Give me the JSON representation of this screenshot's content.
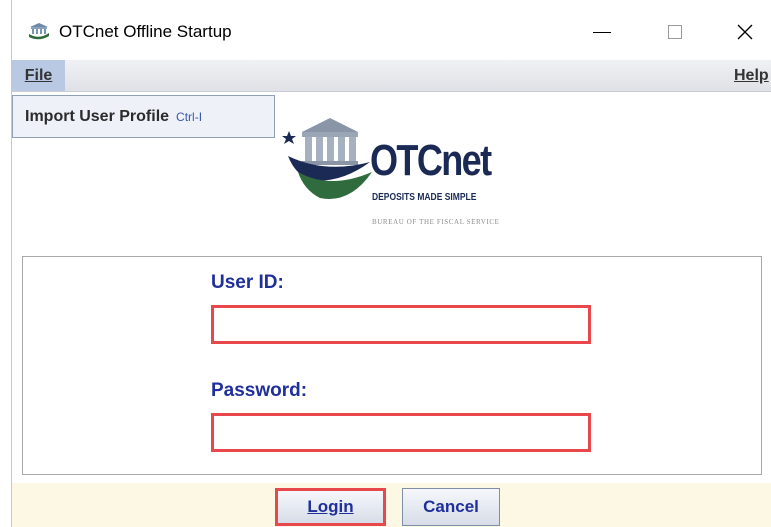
{
  "window": {
    "title": "OTCnet Offline Startup",
    "controls": {
      "minimize": "—",
      "close": "✕"
    }
  },
  "menubar": {
    "file_label": "File",
    "help_label": "Help"
  },
  "file_menu": {
    "items": [
      {
        "label": "Import User Profile",
        "shortcut": "Ctrl-I"
      }
    ]
  },
  "logo": {
    "name": "OTCnet",
    "tagline": "DEPOSITS MADE SIMPLE",
    "agency": "BUREAU OF THE FISCAL SERVICE"
  },
  "login_form": {
    "user_id_label": "User ID:",
    "user_id_value": "",
    "password_label": "Password:",
    "password_value": ""
  },
  "buttons": {
    "login": "Login",
    "cancel": "Cancel"
  },
  "colors": {
    "label_blue": "#1f2f9b",
    "highlight_red": "#e8474b",
    "footer_bg": "#fcf8e3",
    "menu_highlight": "#b9c9e3"
  }
}
